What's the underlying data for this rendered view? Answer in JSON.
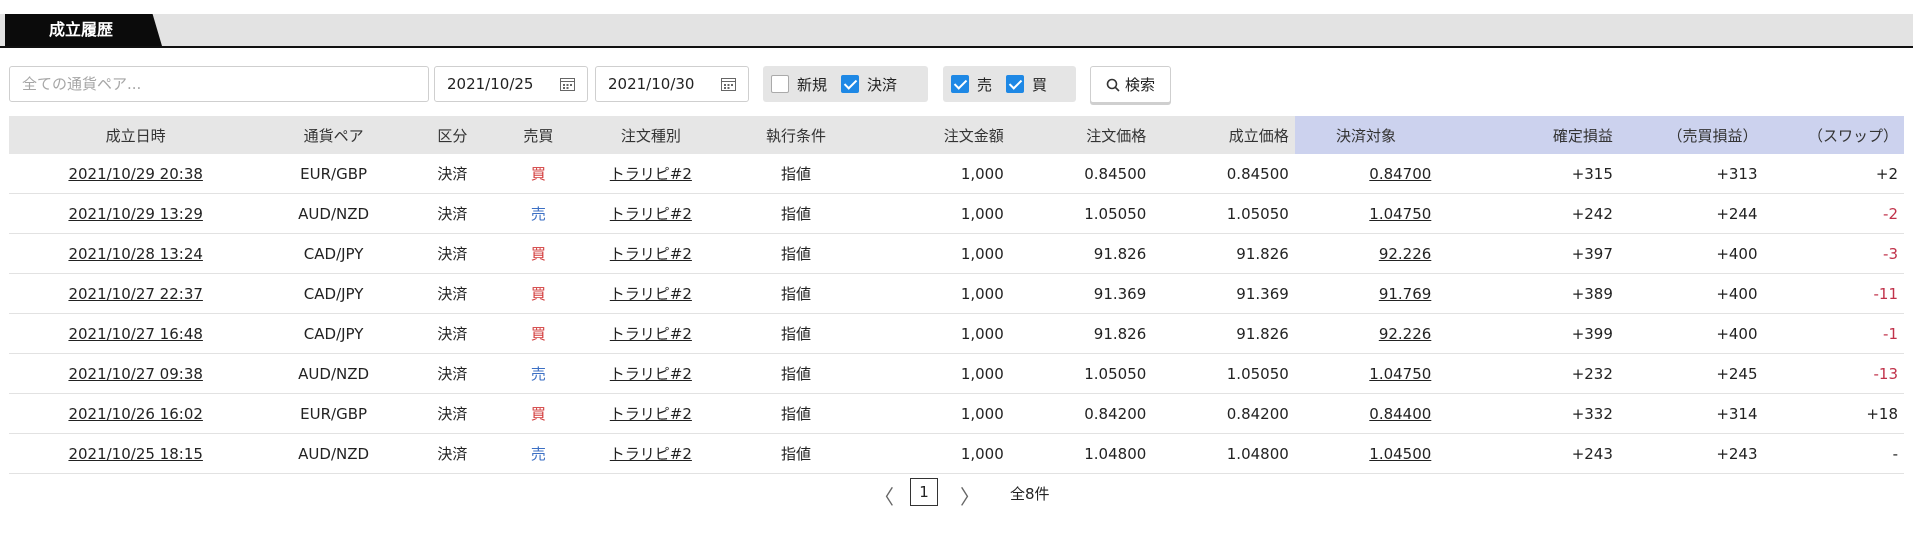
{
  "tab": {
    "label": "成立履歴"
  },
  "filters": {
    "search_placeholder": "全ての通貨ペア...",
    "date_from": "2021/10/25",
    "date_to": "2021/10/30",
    "group1": [
      {
        "label": "新規",
        "checked": false
      },
      {
        "label": "決済",
        "checked": true
      }
    ],
    "group2": [
      {
        "label": "売",
        "checked": true
      },
      {
        "label": "買",
        "checked": true
      }
    ],
    "search_button": "検索"
  },
  "table": {
    "headers": [
      "成立日時",
      "通貨ペア",
      "区分",
      "売買",
      "注文種別",
      "執行条件",
      "注文金額",
      "注文価格",
      "成立価格",
      "決済対象",
      "確定損益",
      "（売買損益）",
      "（スワップ）"
    ],
    "rows": [
      [
        "2021/10/29 20:38",
        "EUR/GBP",
        "決済",
        "買",
        "トラリピ#2",
        "指値",
        "1,000",
        "0.84500",
        "0.84500",
        "0.84700",
        "+315",
        "+313",
        "+2"
      ],
      [
        "2021/10/29 13:29",
        "AUD/NZD",
        "決済",
        "売",
        "トラリピ#2",
        "指値",
        "1,000",
        "1.05050",
        "1.05050",
        "1.04750",
        "+242",
        "+244",
        "-2"
      ],
      [
        "2021/10/28 13:24",
        "CAD/JPY",
        "決済",
        "買",
        "トラリピ#2",
        "指値",
        "1,000",
        "91.826",
        "91.826",
        "92.226",
        "+397",
        "+400",
        "-3"
      ],
      [
        "2021/10/27 22:37",
        "CAD/JPY",
        "決済",
        "買",
        "トラリピ#2",
        "指値",
        "1,000",
        "91.369",
        "91.369",
        "91.769",
        "+389",
        "+400",
        "-11"
      ],
      [
        "2021/10/27 16:48",
        "CAD/JPY",
        "決済",
        "買",
        "トラリピ#2",
        "指値",
        "1,000",
        "91.826",
        "91.826",
        "92.226",
        "+399",
        "+400",
        "-1"
      ],
      [
        "2021/10/27 09:38",
        "AUD/NZD",
        "決済",
        "売",
        "トラリピ#2",
        "指値",
        "1,000",
        "1.05050",
        "1.05050",
        "1.04750",
        "+232",
        "+245",
        "-13"
      ],
      [
        "2021/10/26 16:02",
        "EUR/GBP",
        "決済",
        "買",
        "トラリピ#2",
        "指値",
        "1,000",
        "0.84200",
        "0.84200",
        "0.84400",
        "+332",
        "+314",
        "+18"
      ],
      [
        "2021/10/25 18:15",
        "AUD/NZD",
        "決済",
        "売",
        "トラリピ#2",
        "指値",
        "1,000",
        "1.04800",
        "1.04800",
        "1.04500",
        "+243",
        "+243",
        "-"
      ]
    ]
  },
  "pager": {
    "prev": "〈",
    "current": "1",
    "next": "〉",
    "total": "全8件"
  },
  "colors": {
    "sell": "#3b6fc4",
    "buy": "#d23a3a",
    "negative": "#c0324a",
    "highlight": "#ccd2ee"
  }
}
